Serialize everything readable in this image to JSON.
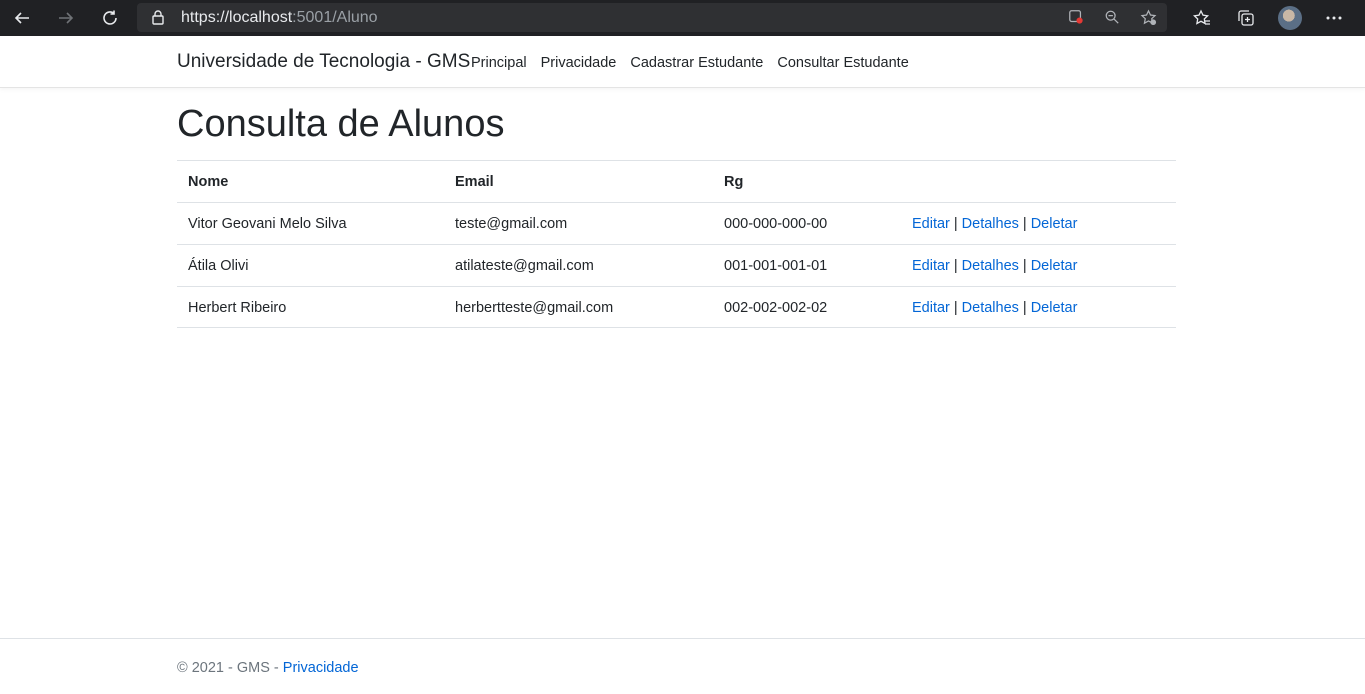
{
  "browser": {
    "url_host": "https://localhost",
    "url_rest": ":5001/Aluno"
  },
  "navbar": {
    "brand": "Universidade de Tecnologia - GMS",
    "links": [
      "Principal",
      "Privacidade",
      "Cadastrar Estudante",
      "Consultar Estudante"
    ]
  },
  "page": {
    "title": "Consulta de Alunos"
  },
  "table": {
    "headers": [
      "Nome",
      "Email",
      "Rg"
    ],
    "actions": {
      "edit": "Editar",
      "details": "Detalhes",
      "delete": "Deletar",
      "separator": "|"
    },
    "rows": [
      {
        "nome": "Vitor Geovani Melo Silva",
        "email": "teste@gmail.com",
        "rg": "000-000-000-00"
      },
      {
        "nome": "Átila Olivi",
        "email": "atilateste@gmail.com",
        "rg": "001-001-001-01"
      },
      {
        "nome": "Herbert Ribeiro",
        "email": "herbertteste@gmail.com",
        "rg": "002-002-002-02"
      }
    ]
  },
  "footer": {
    "text": "© 2021 - GMS - ",
    "link": "Privacidade"
  }
}
